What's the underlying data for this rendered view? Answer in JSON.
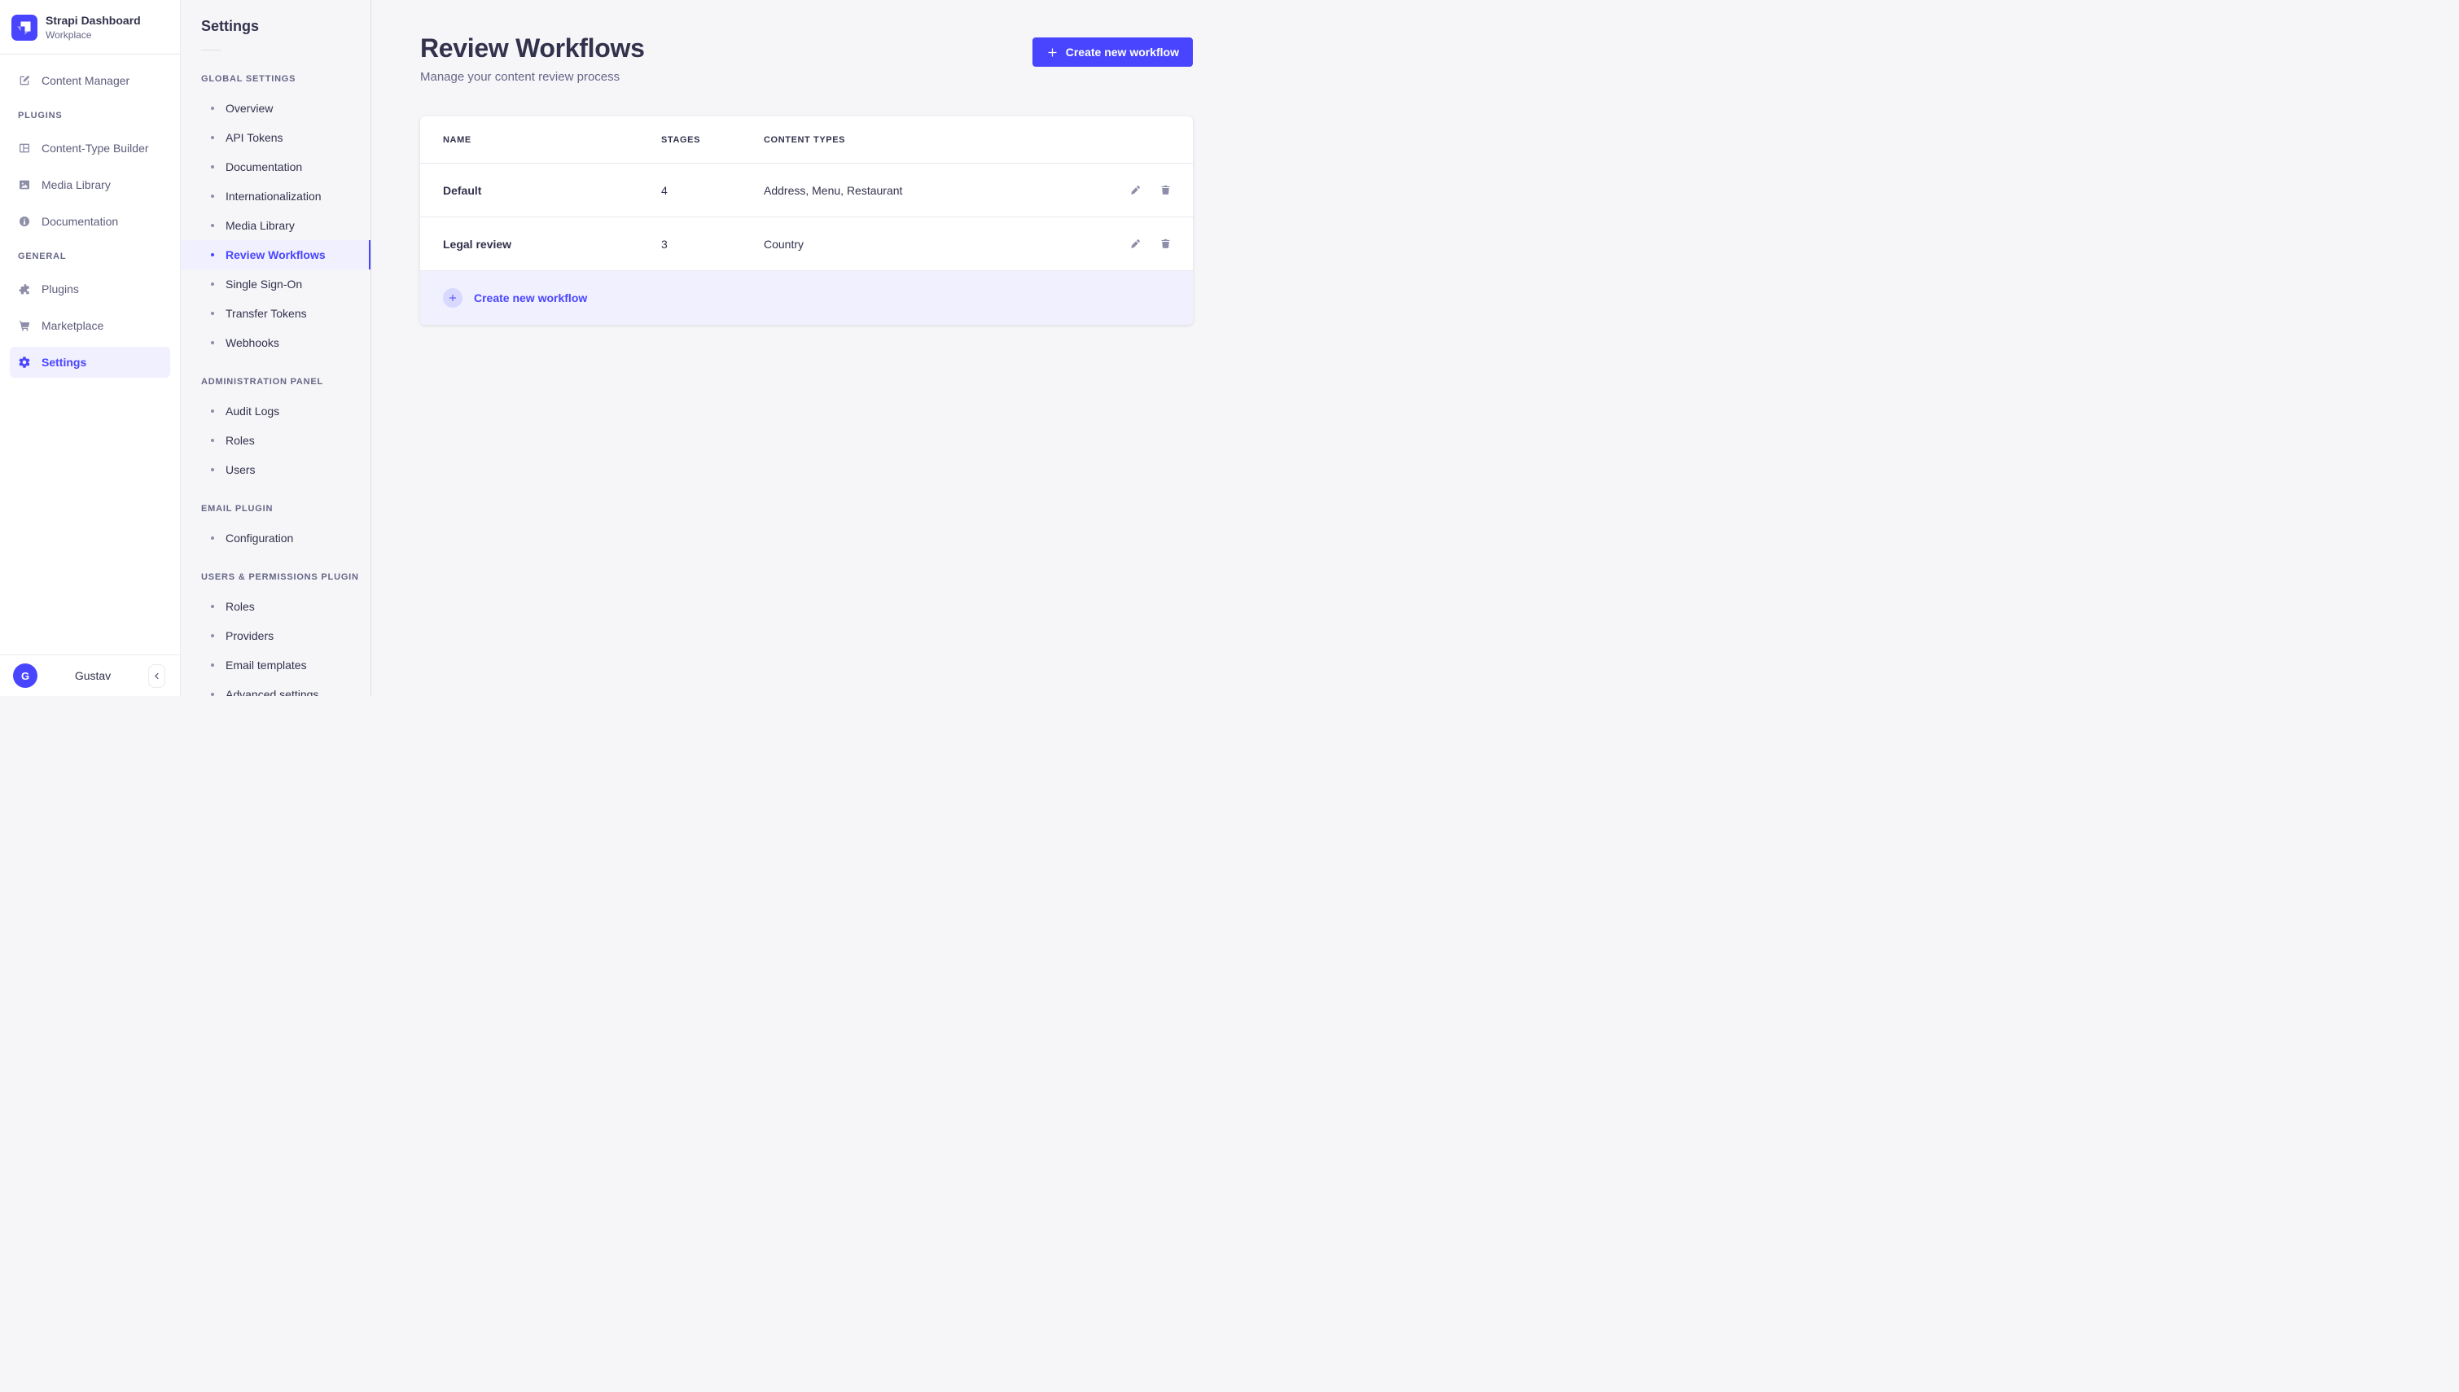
{
  "colors": {
    "primary": "#4945FF",
    "primary_light_bg": "#F0F0FF",
    "primary_circle_bg": "#D9D8FF",
    "text_dark": "#32324D",
    "text_muted": "#666687",
    "icon_gray": "#8E8EA9",
    "border": "#EAEAEF",
    "app_background": "#F6F6F9"
  },
  "brand": {
    "name": "Strapi Dashboard",
    "workspace": "Workplace",
    "logo_icon": "strapi-logo-icon"
  },
  "primary_nav": {
    "items_top": [
      {
        "label": "Content Manager",
        "icon": "content-manager-icon"
      }
    ],
    "sections": [
      {
        "label": "PLUGINS",
        "items": [
          {
            "label": "Content-Type Builder",
            "icon": "content-type-builder-icon"
          },
          {
            "label": "Media Library",
            "icon": "media-library-icon"
          },
          {
            "label": "Documentation",
            "icon": "documentation-icon"
          }
        ]
      },
      {
        "label": "GENERAL",
        "items": [
          {
            "label": "Plugins",
            "icon": "plugins-icon"
          },
          {
            "label": "Marketplace",
            "icon": "marketplace-icon"
          },
          {
            "label": "Settings",
            "icon": "settings-gear-icon",
            "active": true
          }
        ]
      }
    ],
    "user": {
      "initial": "G",
      "name": "Gustav"
    },
    "collapse_icon": "chevron-left-icon"
  },
  "settings_nav": {
    "heading": "Settings",
    "sections": [
      {
        "label": "GLOBAL SETTINGS",
        "active_item": "Review Workflows",
        "items": [
          "Overview",
          "API Tokens",
          "Documentation",
          "Internationalization",
          "Media Library",
          "Review Workflows",
          "Single Sign-On",
          "Transfer Tokens",
          "Webhooks"
        ]
      },
      {
        "label": "ADMINISTRATION PANEL",
        "items": [
          "Audit Logs",
          "Roles",
          "Users"
        ]
      },
      {
        "label": "EMAIL PLUGIN",
        "items": [
          "Configuration"
        ]
      },
      {
        "label": "USERS & PERMISSIONS PLUGIN",
        "items": [
          "Roles",
          "Providers",
          "Email templates",
          "Advanced settings"
        ]
      }
    ]
  },
  "page": {
    "title": "Review Workflows",
    "subtitle": "Manage your content review process",
    "create_button": {
      "label": "Create new workflow",
      "icon": "plus-icon"
    }
  },
  "workflows_table": {
    "columns": [
      "NAME",
      "STAGES",
      "CONTENT TYPES"
    ],
    "rows": [
      {
        "name": "Default",
        "stages": "4",
        "content_types": "Address, Menu, Restaurant",
        "actions": [
          "edit",
          "delete"
        ]
      },
      {
        "name": "Legal review",
        "stages": "3",
        "content_types": "Country",
        "actions": [
          "edit",
          "delete"
        ]
      }
    ],
    "footer_action": {
      "label": "Create new workflow",
      "icon": "plus-icon"
    }
  }
}
